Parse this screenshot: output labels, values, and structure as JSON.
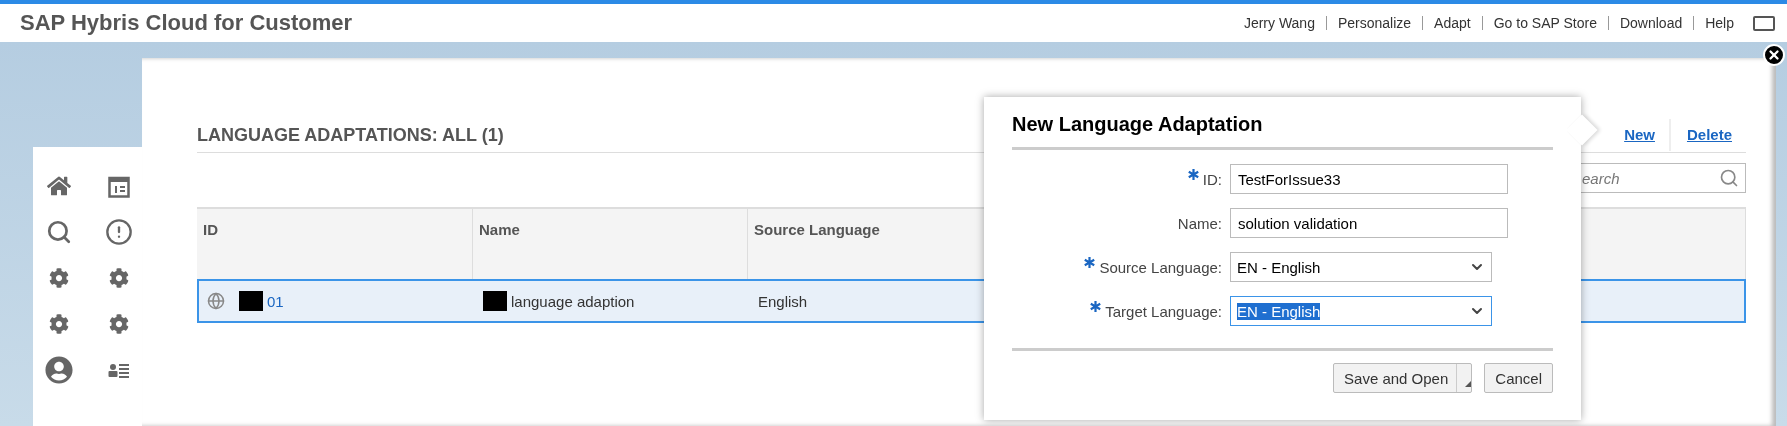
{
  "header": {
    "title": "SAP Hybris Cloud for Customer",
    "links": [
      "Jerry Wang",
      "Personalize",
      "Adapt",
      "Go to SAP Store",
      "Download",
      "Help"
    ]
  },
  "list": {
    "title": "LANGUAGE ADAPTATIONS: ALL (1)",
    "actions": [
      "New",
      "Delete"
    ],
    "search": {
      "placeholder": "earch"
    },
    "table": {
      "columns": [
        "ID",
        "Name",
        "Source Language"
      ],
      "rows": [
        {
          "selected": true,
          "id": "01",
          "name": "language adaption",
          "source_language": "English"
        }
      ]
    }
  },
  "dialog": {
    "title": "New Language Adaptation",
    "fields": [
      {
        "kind": "text",
        "label": "ID:",
        "required": true,
        "value": "TestForIssue33",
        "focused": false
      },
      {
        "kind": "text",
        "label": "Name:",
        "required": false,
        "value": "solution validation",
        "focused": false
      },
      {
        "kind": "select",
        "label": "Source Language:",
        "required": true,
        "value": "EN - English",
        "focused": false
      },
      {
        "kind": "select",
        "label": "Target Language:",
        "required": true,
        "value": "EN - English",
        "focused": true
      }
    ],
    "buttons": [
      {
        "label": "Save and Open",
        "has_menu": true
      },
      {
        "label": "Cancel",
        "has_menu": false
      }
    ]
  }
}
